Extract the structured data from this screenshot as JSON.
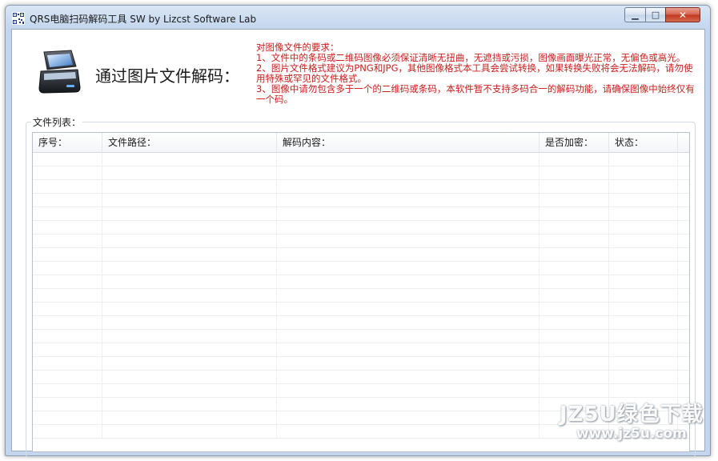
{
  "window": {
    "title": "QRS电脑扫码解码工具 SW  by Lizcst Software Lab",
    "minimize_glyph": "▁",
    "maximize_glyph": "□",
    "close_glyph": "✕"
  },
  "header": {
    "heading": "通过图片文件解码：",
    "icon": "scanner-icon"
  },
  "requirements": {
    "title": "对图像文件的要求：",
    "items": [
      "1、文件中的条码或二维码图像必须保证清晰无扭曲，无遮挡或污损，图像画面曝光正常，无偏色或高光。",
      "2、图片文件格式建议为PNG和JPG，其他图像格式本工具会尝试转换，如果转换失败将会无法解码，请勿使用特殊或罕见的文件格式。",
      "3、图像中请勿包含多于一个的二维码或条码，本软件暂不支持多码合一的解码功能，请确保图像中始终仅有一个码。"
    ],
    "color": "#cc1c1c"
  },
  "file_list": {
    "group_label": "文件列表：",
    "columns": [
      {
        "label": "序号："
      },
      {
        "label": "文件路径："
      },
      {
        "label": "解码内容："
      },
      {
        "label": "是否加密："
      },
      {
        "label": "状态："
      }
    ],
    "rows": []
  },
  "watermark": {
    "main": "JZ5U绿色下载",
    "sub": "www.jz5u.com"
  }
}
